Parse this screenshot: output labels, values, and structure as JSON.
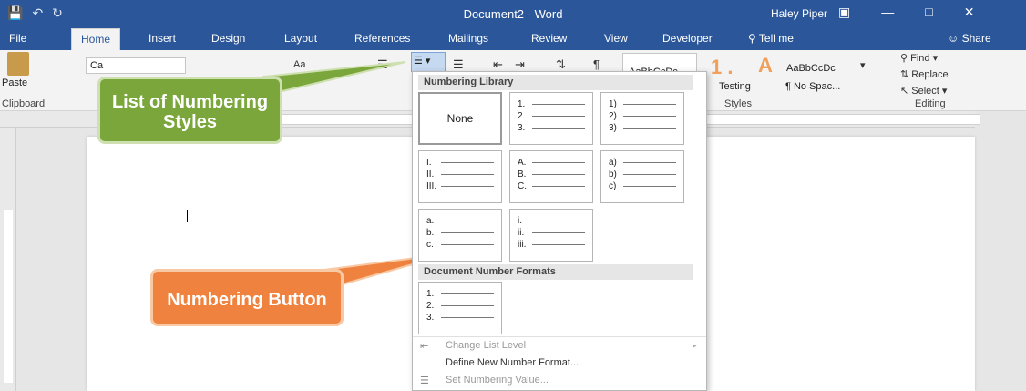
{
  "titlebar": {
    "save_icon": "save-icon",
    "undo_icon": "undo-icon",
    "redo_icon": "redo-icon",
    "title": "Document2  -  Word",
    "user": "Haley Piper"
  },
  "tabs": [
    "File",
    "Home",
    "Insert",
    "Design",
    "Layout",
    "References",
    "Mailings",
    "Review",
    "View",
    "Developer"
  ],
  "tell_me": "Tell me",
  "share": "Share",
  "ribbon": {
    "paste_label": "Paste",
    "clipboard_label": "Clipboard",
    "font_value": "Ca",
    "aa_label": "Aa",
    "styles": {
      "normal_sample": "AaBbCcDc",
      "heading_sample": "AaBbCcDc",
      "testing": "Testing",
      "no_spacing": "¶ No Spac...",
      "label": "Styles"
    },
    "editing": {
      "find": "Find",
      "replace": "Replace",
      "select": "Select",
      "label": "Editing"
    }
  },
  "callouts": {
    "list_styles": "List of Numbering Styles",
    "numbering_button": "Numbering Button"
  },
  "dropdown": {
    "library_header": "Numbering Library",
    "document_header": "Document Number Formats",
    "none_label": "None",
    "tiles": [
      [
        "1.",
        "2.",
        "3."
      ],
      [
        "1)",
        "2)",
        "3)"
      ],
      [
        "I.",
        "II.",
        "III."
      ],
      [
        "A.",
        "B.",
        "C."
      ],
      [
        "a)",
        "b)",
        "c)"
      ],
      [
        "a.",
        "b.",
        "c."
      ],
      [
        "i.",
        "ii.",
        "iii."
      ]
    ],
    "doc_tile": [
      "1.",
      "2.",
      "3."
    ],
    "menu": {
      "change_level": "Change List Level",
      "define_new": "Define New Number Format...",
      "set_value": "Set Numbering Value..."
    }
  },
  "colors": {
    "word_blue": "#2b579a",
    "callout_green": "#7aa63c",
    "callout_orange": "#f08240"
  }
}
